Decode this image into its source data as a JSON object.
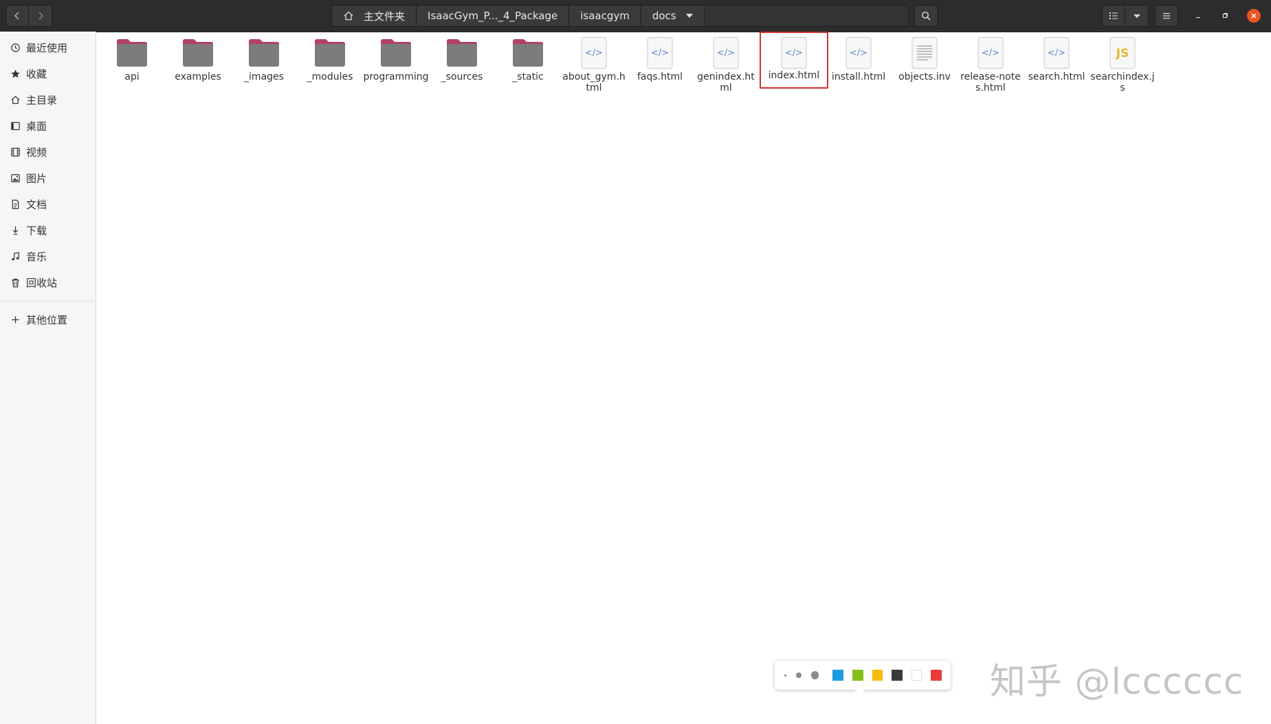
{
  "header": {
    "breadcrumbs": [
      "主文件夹",
      "IsaacGym_P..._4_Package",
      "isaacgym",
      "docs"
    ],
    "icons": {
      "back": "chevron-left-icon",
      "forward": "chevron-right-icon",
      "home": "home-icon",
      "search": "search-icon",
      "list_view": "list-view-icon",
      "view_options": "chevron-down-icon",
      "menu": "hamburger-menu-icon",
      "minimize": "minimize-icon",
      "restore": "restore-icon",
      "close": "close-icon"
    }
  },
  "sidebar": {
    "items": [
      {
        "label": "最近使用",
        "icon": "clock-icon"
      },
      {
        "label": "收藏",
        "icon": "star-icon"
      },
      {
        "label": "主目录",
        "icon": "home-icon"
      },
      {
        "label": "桌面",
        "icon": "desktop-icon"
      },
      {
        "label": "视频",
        "icon": "video-icon"
      },
      {
        "label": "图片",
        "icon": "picture-icon"
      },
      {
        "label": "文档",
        "icon": "document-icon"
      },
      {
        "label": "下载",
        "icon": "download-icon"
      },
      {
        "label": "音乐",
        "icon": "music-icon"
      },
      {
        "label": "回收站",
        "icon": "trash-icon"
      },
      {
        "label": "其他位置",
        "icon": "plus-icon"
      }
    ]
  },
  "files": [
    {
      "name": "api",
      "type": "folder"
    },
    {
      "name": "examples",
      "type": "folder"
    },
    {
      "name": "_images",
      "type": "folder"
    },
    {
      "name": "_modules",
      "type": "folder"
    },
    {
      "name": "programming",
      "type": "folder"
    },
    {
      "name": "_sources",
      "type": "folder"
    },
    {
      "name": "_static",
      "type": "folder"
    },
    {
      "name": "about_gym.html",
      "type": "html"
    },
    {
      "name": "faqs.html",
      "type": "html"
    },
    {
      "name": "genindex.html",
      "type": "html"
    },
    {
      "name": "index.html",
      "type": "html",
      "selected": true
    },
    {
      "name": "install.html",
      "type": "html"
    },
    {
      "name": "objects.inv",
      "type": "text"
    },
    {
      "name": "release-notes.html",
      "type": "html"
    },
    {
      "name": "search.html",
      "type": "html"
    },
    {
      "name": "searchindex.js",
      "type": "js",
      "badge": "JS"
    }
  ],
  "palette": {
    "dot_sizes": [
      "small",
      "medium",
      "large"
    ],
    "colors": [
      "#1e9ae0",
      "#84c01c",
      "#f8b90f",
      "#3a3a3a",
      "#ffffff",
      "#e93c3c"
    ]
  },
  "watermark": "知乎 @lcccccc",
  "colors": {
    "headerbar": "#2c2c2c",
    "folder_top": "#b44165",
    "folder_body": "#7c7c7c",
    "selection_border": "#d0312d",
    "html_glyph": "#5a86c9",
    "js_badge": "#e8b92a"
  }
}
